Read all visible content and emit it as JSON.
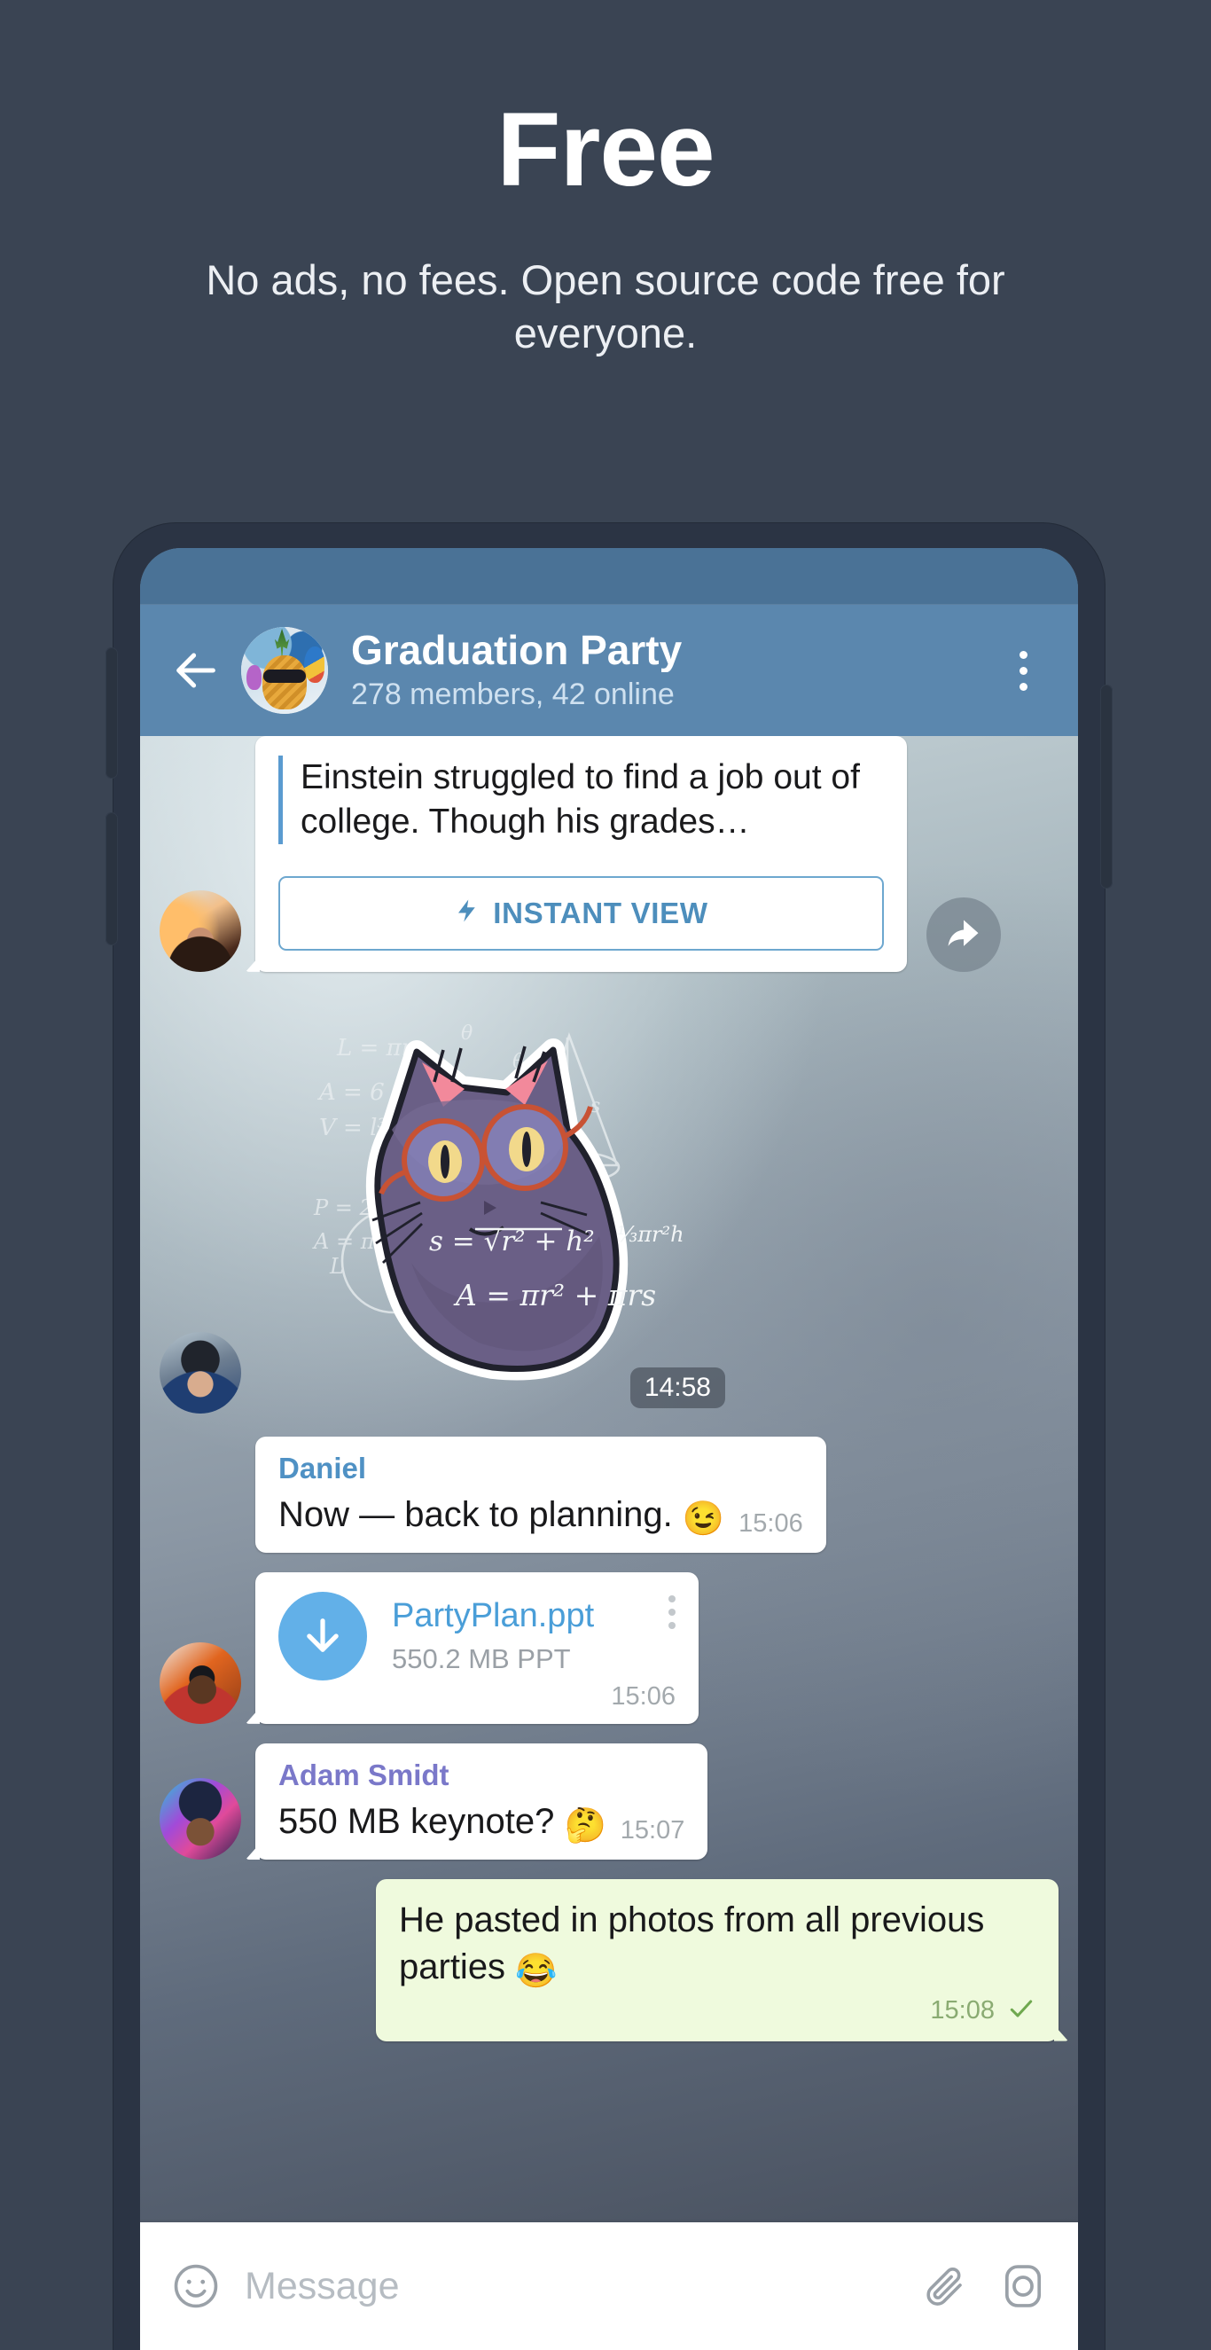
{
  "promo": {
    "title": "Free",
    "subtitle": "No ads, no fees. Open source code free for everyone."
  },
  "chat": {
    "header": {
      "back_icon": "back-arrow-icon",
      "avatar_icon": "group-avatar",
      "title": "Graduation Party",
      "subtitle": "278 members, 42 online",
      "menu_icon": "kebab-menu-icon"
    },
    "messages": [
      {
        "type": "link_preview",
        "avatar": "av1",
        "quote": "Einstein struggled to find a job out of college. Though his grades…",
        "button_label": "INSTANT VIEW",
        "button_icon": "lightning-bolt-icon",
        "forward_icon": "forward-arrow-icon"
      },
      {
        "type": "sticker",
        "avatar": "av2",
        "sticker_name": "math-cat-sticker",
        "time": "14:58"
      },
      {
        "type": "text",
        "sender": "Daniel",
        "sender_color": "#4f91c4",
        "text": "Now — back to planning.",
        "emoji": "😉",
        "time": "15:06"
      },
      {
        "type": "file",
        "avatar": "av3",
        "file_name": "PartyPlan.ppt",
        "file_meta": "550.2 MB PPT",
        "download_icon": "download-arrow-icon",
        "menu_icon": "kebab-menu-icon",
        "time": "15:06"
      },
      {
        "type": "text",
        "avatar": "av4",
        "sender": "Adam Smidt",
        "sender_color": "#7a78c9",
        "text": "550 MB keynote?",
        "emoji": "🤔",
        "time": "15:07"
      },
      {
        "type": "outgoing",
        "text": "He pasted in photos from all previous parties",
        "emoji": "😂",
        "time": "15:08",
        "status_icon": "sent-check-icon"
      }
    ],
    "input": {
      "emoji_icon": "smiley-icon",
      "placeholder": "Message",
      "attach_icon": "paperclip-icon",
      "camera_icon": "camera-icon"
    }
  },
  "colors": {
    "page_bg": "#3a4453",
    "header_blue": "#5b87ae",
    "status_blue": "#4a7296",
    "accent_blue": "#4a9ed8",
    "outgoing_green": "#effadd"
  }
}
